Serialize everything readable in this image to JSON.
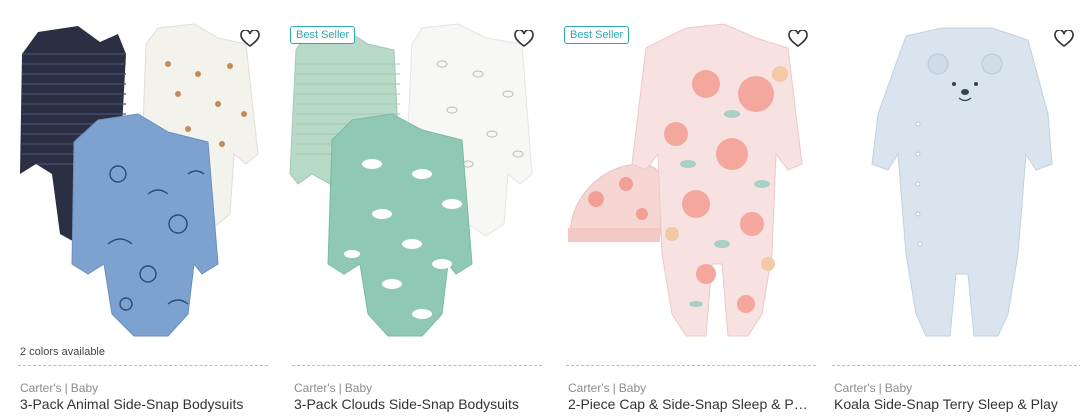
{
  "products": [
    {
      "colors_available": "2 colors available",
      "brand": "Carter's",
      "category": "Baby",
      "title": "3-Pack Animal Side-Snap Bodysuits",
      "badge": ""
    },
    {
      "colors_available": "",
      "brand": "Carter's",
      "category": "Baby",
      "title": "3-Pack Clouds Side-Snap Bodysuits",
      "badge": "Best Seller"
    },
    {
      "colors_available": "",
      "brand": "Carter's",
      "category": "Baby",
      "title": "2-Piece Cap & Side-Snap Sleep & Pla...",
      "badge": "Best Seller"
    },
    {
      "colors_available": "",
      "brand": "Carter's",
      "category": "Baby",
      "title": "Koala Side-Snap Terry Sleep & Play",
      "badge": ""
    }
  ],
  "icons": {
    "favorite": "heart-outline-icon"
  },
  "colors": {
    "badge": "#2ba7b3",
    "divider": "#bdbdbd",
    "brand_text": "#8c8c8c"
  }
}
